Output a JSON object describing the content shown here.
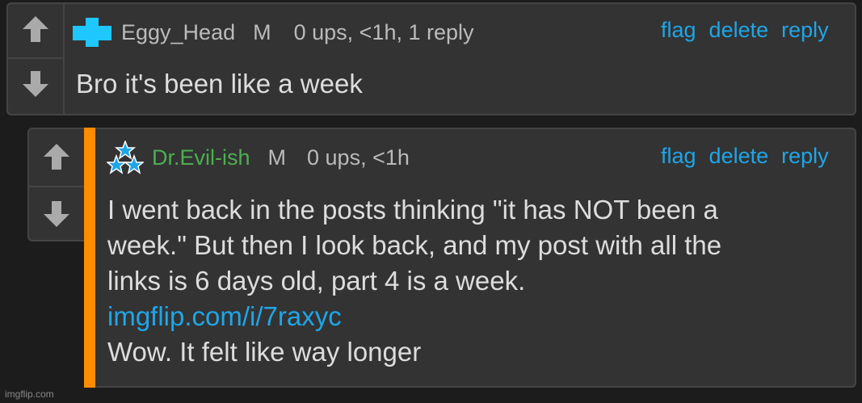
{
  "comments": [
    {
      "username": "Eggy_Head",
      "mod_badge": "M",
      "meta": "0 ups, <1h, 1 reply",
      "actions": [
        "flag",
        "delete",
        "reply"
      ],
      "body_lines": [
        "Bro it's been like a week"
      ],
      "username_color": "#bbbbbb",
      "avatar_icon": "blue-cross-icon"
    },
    {
      "username": "Dr.Evil-ish",
      "mod_badge": "M",
      "meta": "0 ups, <1h",
      "actions": [
        "flag",
        "delete",
        "reply"
      ],
      "body_lines": [
        "I went back in the posts thinking \"it has NOT been a",
        "week.\" But then I look back, and my post with all the",
        "links is 6 days old, part 4 is a week."
      ],
      "link": "imgflip.com/i/7raxyc",
      "body_after_link": "Wow. It felt like way longer",
      "username_color": "#4caf50",
      "avatar_icon": "stars-triangle-icon"
    }
  ],
  "watermark": "imgflip.com",
  "colors": {
    "background": "#1c1c1c",
    "panel": "#333333",
    "border": "#444444",
    "link": "#1ea6e8",
    "reply_bar": "#ff8c00"
  }
}
